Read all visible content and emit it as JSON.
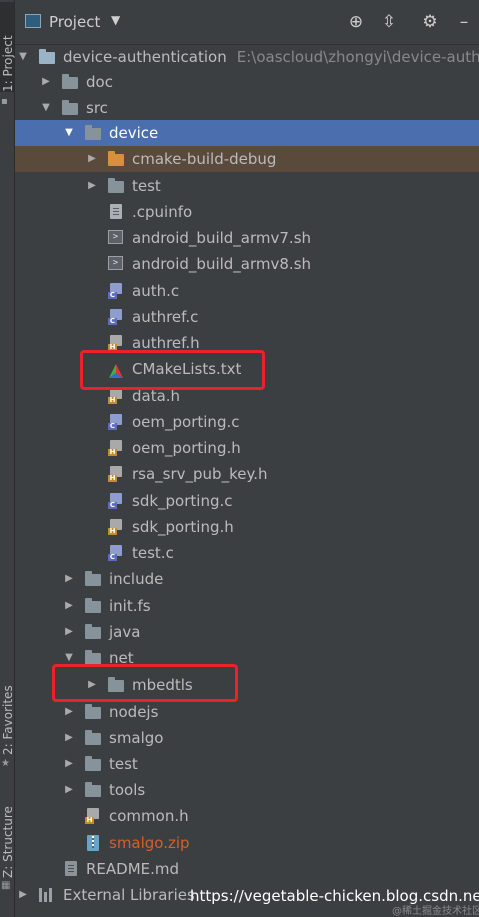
{
  "side_tabs": {
    "project": "1: Project",
    "favorites": "2: Favorites",
    "structure": "Z: Structure"
  },
  "header": {
    "title": "Project",
    "icons": [
      "locate-target-icon",
      "collapse-all-icon",
      "gear-icon",
      "hide-minimize-icon"
    ]
  },
  "tree": {
    "root": {
      "name": "device-authentication",
      "path": "E:\\oascloud\\zhongyi\\device-authe"
    },
    "doc": "doc",
    "src": "src",
    "device": "device",
    "cmake_build_debug": "cmake-build-debug",
    "test_dir": "test",
    "cpuinfo": ".cpuinfo",
    "android_v7": "android_build_armv7.sh",
    "android_v8": "android_build_armv8.sh",
    "auth_c": "auth.c",
    "authref_c": "authref.c",
    "authref_h": "authref.h",
    "cmakelists": "CMakeLists.txt",
    "data_h": "data.h",
    "oem_porting_c": "oem_porting.c",
    "oem_porting_h": "oem_porting.h",
    "rsa_key_h": "rsa_srv_pub_key.h",
    "sdk_porting_c": "sdk_porting.c",
    "sdk_porting_h": "sdk_porting.h",
    "test_c": "test.c",
    "include": "include",
    "init_fs": "init.fs",
    "java": "java",
    "net": "net",
    "mbedtls": "mbedtls",
    "nodejs": "nodejs",
    "smalgo": "smalgo",
    "test2": "test",
    "tools": "tools",
    "common_h": "common.h",
    "smalgo_zip": "smalgo.zip",
    "readme": "README.md",
    "external_libraries": "External Libraries"
  },
  "watermark": {
    "url": "https://vegetable-chicken.blog.csdn.net",
    "sub": "@稀土掘金技术社区"
  },
  "colors": {
    "background": "#3c3f41",
    "selection": "#4b6eaf",
    "excluded_row": "#5a4a3c",
    "highlight_box": "#e8232a",
    "zip_text": "#d4602a"
  }
}
